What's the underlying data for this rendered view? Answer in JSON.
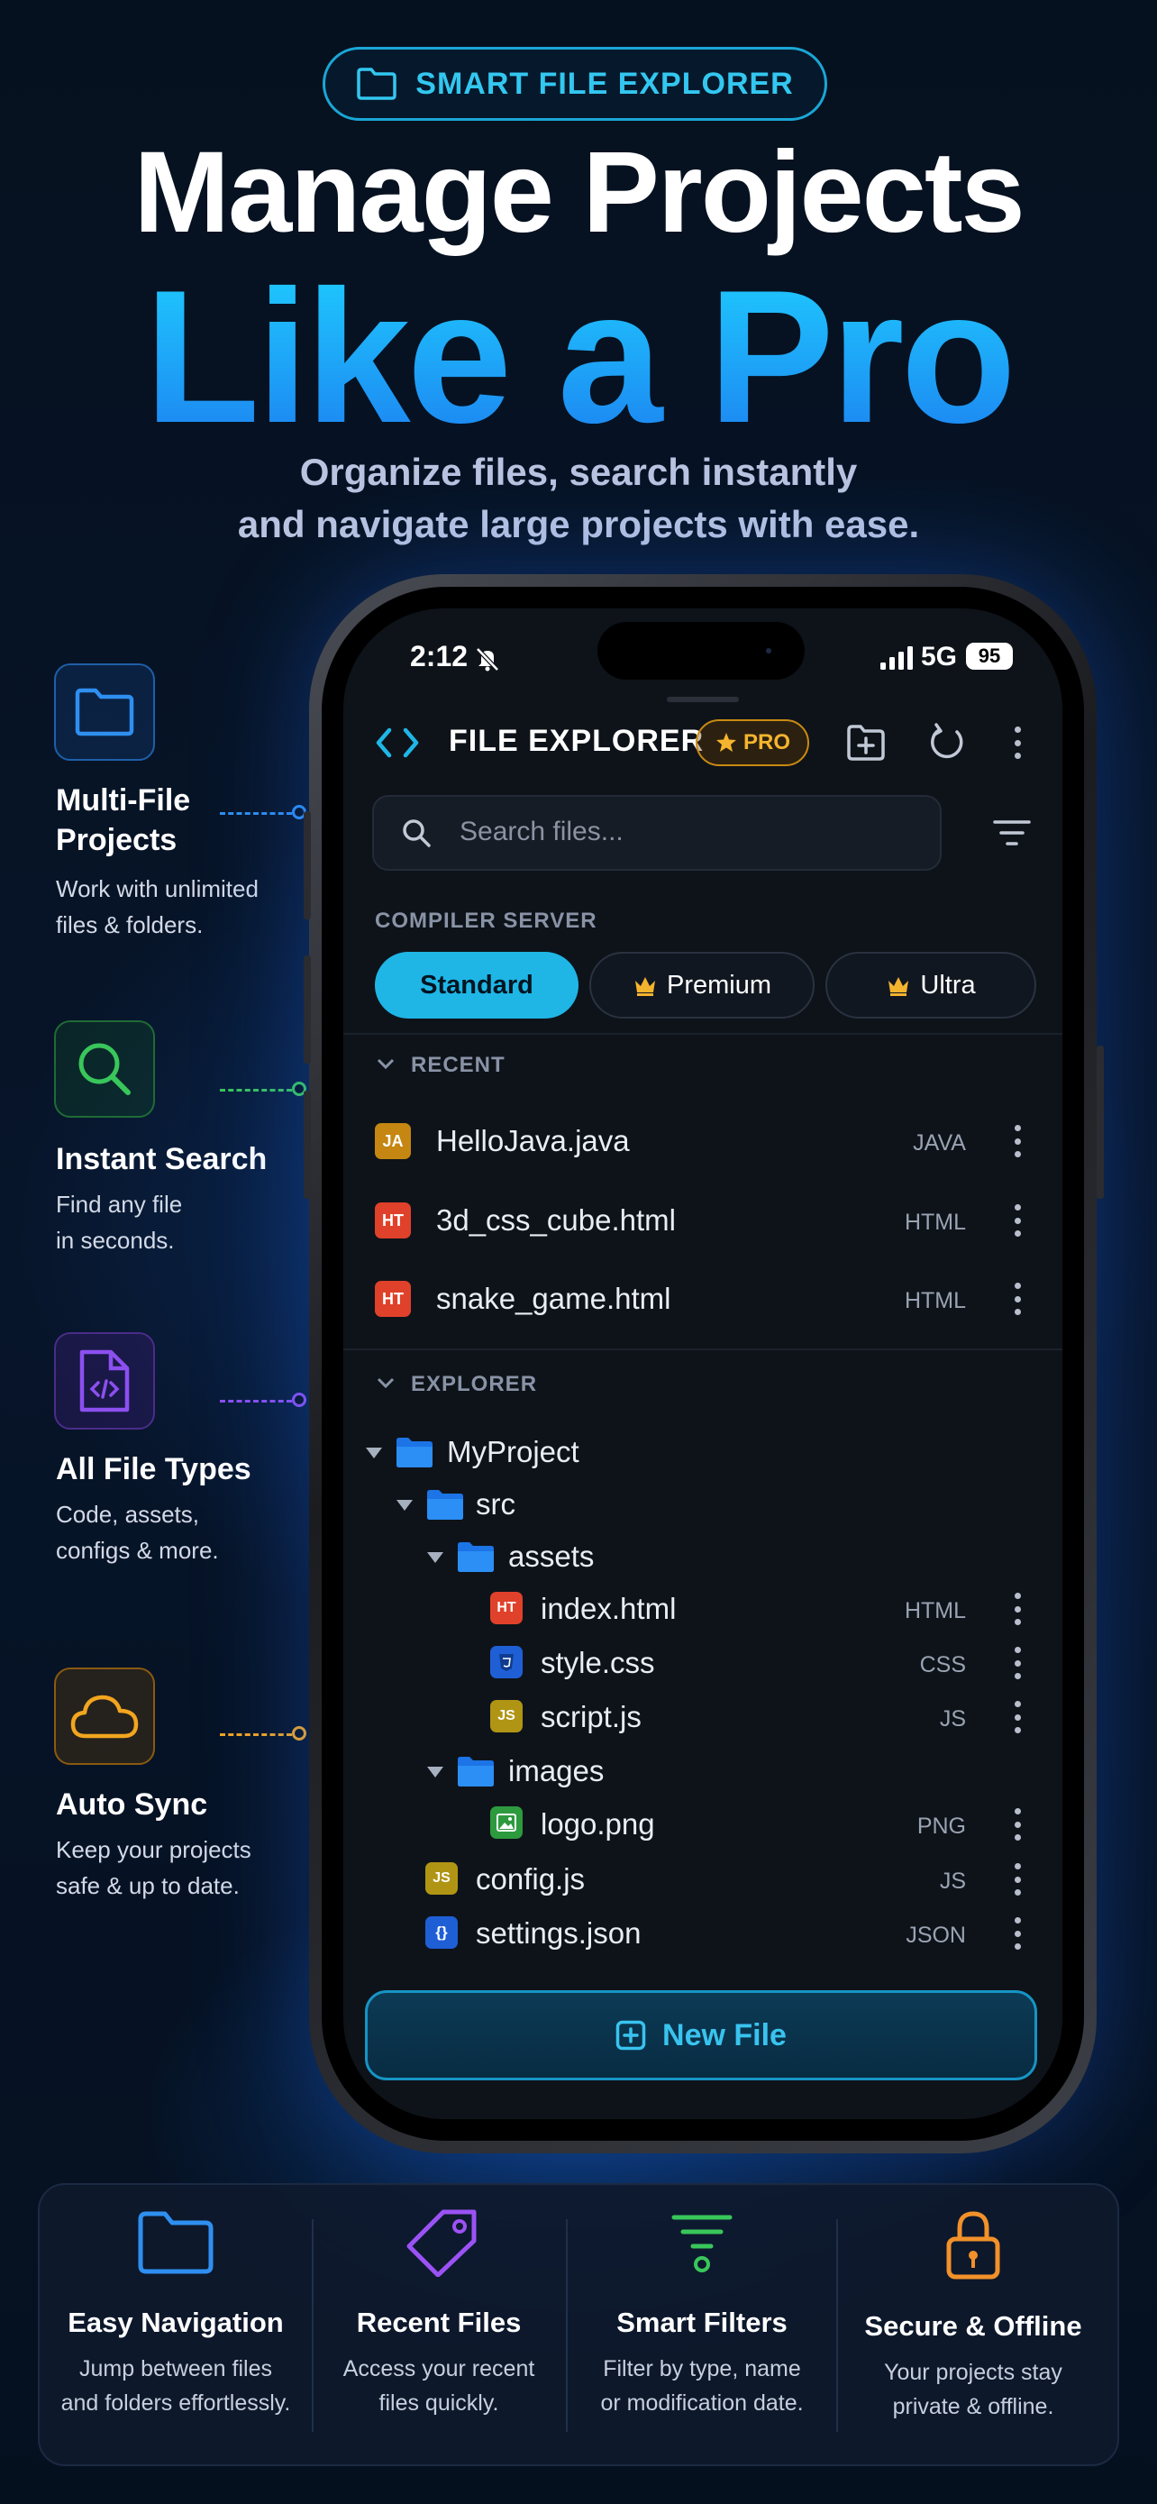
{
  "badge": {
    "label": "SMART FILE EXPLORER"
  },
  "hero": {
    "line1": "Manage Projects",
    "line2": "Like a Pro",
    "sub1": "Organize files, search instantly",
    "sub2": "and navigate large projects with ease."
  },
  "features": [
    {
      "title1": "Multi-File",
      "title2": "Projects",
      "desc1": "Work with unlimited",
      "desc2": "files & folders.",
      "icon": "folder-icon",
      "color": "#2f8ff0"
    },
    {
      "title1": "Instant Search",
      "desc1": "Find any file",
      "desc2": "in seconds.",
      "icon": "search-icon",
      "color": "#39c65a"
    },
    {
      "title1": "All File Types",
      "desc1": "Code, assets,",
      "desc2": "configs & more.",
      "icon": "code-file-icon",
      "color": "#8c4ff0"
    },
    {
      "title1": "Auto Sync",
      "desc1": "Keep your projects",
      "desc2": "safe & up to date.",
      "icon": "cloud-icon",
      "color": "#f2a51f"
    }
  ],
  "status_bar": {
    "time": "2:12",
    "network": "5G",
    "battery": "95"
  },
  "app_bar": {
    "title": "FILE EXPLORER",
    "pro": "PRO"
  },
  "search": {
    "placeholder": "Search files..."
  },
  "compiler": {
    "label": "COMPILER SERVER",
    "options": [
      "Standard",
      "Premium",
      "Ultra"
    ],
    "selected": "Standard"
  },
  "recent": {
    "label": "RECENT",
    "files": [
      {
        "tag": "JA",
        "name": "HelloJava.java",
        "type": "JAVA"
      },
      {
        "tag": "HT",
        "name": "3d_css_cube.html",
        "type": "HTML"
      },
      {
        "tag": "HT",
        "name": "snake_game.html",
        "type": "HTML"
      }
    ]
  },
  "explorer": {
    "label": "EXPLORER",
    "tree": [
      {
        "kind": "folder",
        "name": "MyProject",
        "depth": 0
      },
      {
        "kind": "folder",
        "name": "src",
        "depth": 1
      },
      {
        "kind": "folder",
        "name": "assets",
        "depth": 2
      },
      {
        "kind": "file",
        "tag": "HT",
        "name": "index.html",
        "type": "HTML",
        "depth": 3
      },
      {
        "kind": "file",
        "tag": "css",
        "name": "style.css",
        "type": "CSS",
        "depth": 3
      },
      {
        "kind": "file",
        "tag": "JS",
        "name": "script.js",
        "type": "JS",
        "depth": 3
      },
      {
        "kind": "folder",
        "name": "images",
        "depth": 2
      },
      {
        "kind": "file",
        "tag": "img",
        "name": "logo.png",
        "type": "PNG",
        "depth": 3
      },
      {
        "kind": "file",
        "tag": "JS",
        "name": "config.js",
        "type": "JS",
        "depth": 1
      },
      {
        "kind": "file",
        "tag": "{}",
        "name": "settings.json",
        "type": "JSON",
        "depth": 1
      }
    ]
  },
  "new_file": {
    "label": "New File"
  },
  "bottom": [
    {
      "title": "Easy Navigation",
      "desc1": "Jump between files",
      "desc2": "and folders effortlessly.",
      "icon": "folder-icon",
      "color": "#2f8ff0"
    },
    {
      "title": "Recent Files",
      "desc1": "Access your recent",
      "desc2": "files quickly.",
      "icon": "tag-icon",
      "color": "#9b52f5"
    },
    {
      "title": "Smart Filters",
      "desc1": "Filter by type, name",
      "desc2": "or modification date.",
      "icon": "filter-icon",
      "color": "#39c65a"
    },
    {
      "title": "Secure & Offline",
      "desc1": "Your projects stay",
      "desc2": "private & offline.",
      "icon": "lock-icon",
      "color": "#f2912a"
    }
  ],
  "colors": {
    "accent": "#1fb6e6",
    "pro": "#f5b42e",
    "background": "#05101f"
  }
}
